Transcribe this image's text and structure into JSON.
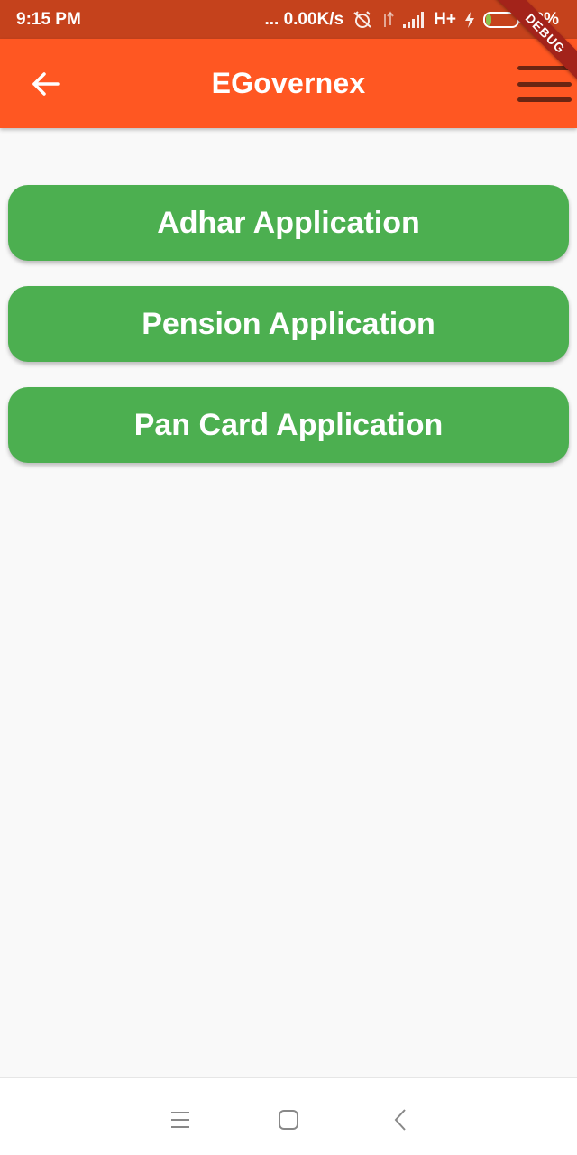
{
  "status_bar": {
    "time": "9:15 PM",
    "network_speed": "... 0.00K/s",
    "network_type": "H+",
    "battery": "13%",
    "icons": [
      "alarm-off-icon",
      "data-arrows-icon",
      "signal-icon",
      "charging-icon",
      "battery-icon"
    ]
  },
  "app_bar": {
    "title": "EGovernex",
    "back_icon": "arrow-left-icon",
    "menu_icon": "hamburger-menu-icon"
  },
  "debug_banner": "DEBUG",
  "buttons": [
    {
      "label": "Adhar Application"
    },
    {
      "label": "Pension Application"
    },
    {
      "label": "Pan Card Application"
    }
  ],
  "nav_bar": {
    "icons": [
      "recents-icon",
      "home-icon",
      "back-icon"
    ]
  },
  "colors": {
    "status_bar": "#c5421c",
    "app_bar": "#ff5722",
    "button": "#4caf50",
    "background": "#f9f9f9",
    "debug_banner": "#a3231a"
  }
}
